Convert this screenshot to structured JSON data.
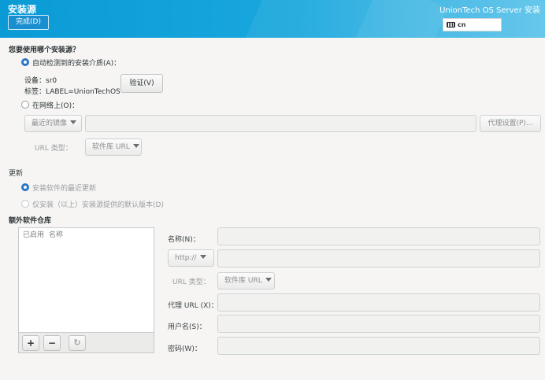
{
  "header": {
    "title": "安装源",
    "done_label": "完成(D)",
    "product": "UnionTech OS Server 安装",
    "keyboard_layout": "cn"
  },
  "source": {
    "question": "您要使用哪个安装源？",
    "auto_detect_label": "自动检测到的安装介质(A)：",
    "device_line": "设备：sr0",
    "label_line": "标签：LABEL=UnionTechOS",
    "verify_label": "验证(V)",
    "network_label": "在网络上(O)：",
    "mirror_dropdown": "最近的镜像",
    "proxy_label": "代理设置(P)...",
    "url_type_label": "URL 类型：",
    "url_type_value": "软件库 URL"
  },
  "updates": {
    "title": "更新",
    "latest_label": "安装软件的最近更新",
    "default_label": "仅安装（以上）安装源提供的默认版本(D)"
  },
  "extra": {
    "title": "额外软件仓库",
    "col_enabled": "已启用",
    "col_name": "名称",
    "add_symbol": "+",
    "remove_symbol": "−",
    "refresh_icon": "refresh-icon",
    "name_label": "名称(N)：",
    "protocol_value": "http://",
    "url_type_label": "URL 类型：",
    "url_type_value": "软件库 URL",
    "proxy_url_label": "代理 URL (X)：",
    "username_label": "用户名(S)：",
    "password_label": "密码(W)："
  },
  "colors": {
    "header_blue": "#0a9bd6",
    "radio_selected": "#2a76c6",
    "background": "#f6f5f4"
  }
}
